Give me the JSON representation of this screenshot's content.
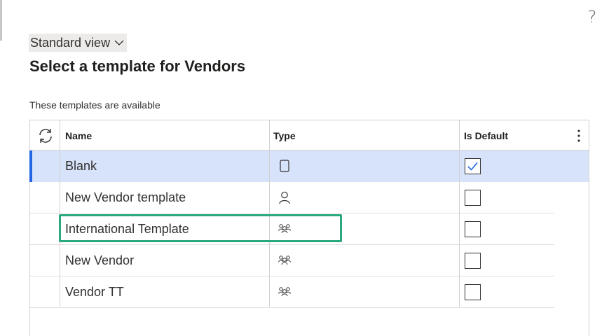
{
  "help_glyph": "?",
  "view_selector": {
    "label": "Standard view"
  },
  "title": "Select a template for Vendors",
  "subtitle": "These templates are available",
  "grid": {
    "columns": {
      "name": "Name",
      "type": "Type",
      "is_default": "Is Default"
    },
    "rows": [
      {
        "name": "Blank",
        "type_icon": "blank-document-icon",
        "is_default": true,
        "selected": true
      },
      {
        "name": "New Vendor template",
        "type_icon": "single-person-icon",
        "is_default": false,
        "selected": false
      },
      {
        "name": "International Template",
        "type_icon": "people-group-icon",
        "is_default": false,
        "selected": false
      },
      {
        "name": "New Vendor",
        "type_icon": "people-group-icon",
        "is_default": false,
        "selected": false
      },
      {
        "name": "Vendor TT",
        "type_icon": "people-group-icon",
        "is_default": false,
        "selected": false
      }
    ]
  },
  "colors": {
    "selection": "#d7e3fa",
    "selection_bar": "#2266e3",
    "highlight_box": "#2aa87f"
  }
}
